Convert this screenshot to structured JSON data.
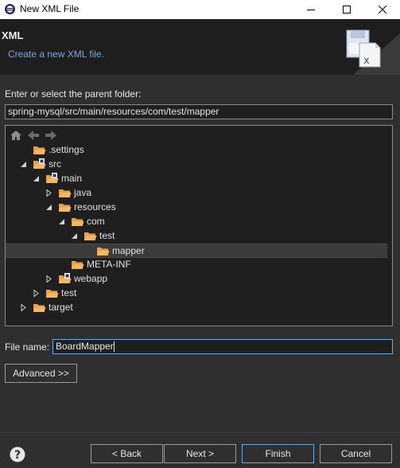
{
  "window": {
    "title": "New XML File",
    "controls": {
      "minimize": "minimize-icon",
      "maximize": "maximize-icon",
      "close": "close-icon"
    }
  },
  "header": {
    "title": "XML",
    "description": "Create a new XML file."
  },
  "parent_folder": {
    "label": "Enter or select the parent folder:",
    "value": "spring-mysql/src/main/resources/com/test/mapper"
  },
  "tree": {
    "toolbar": [
      "home-icon",
      "back-arrow-icon",
      "forward-arrow-icon"
    ],
    "nodes": [
      {
        "label": ".settings",
        "expander": "none",
        "badge": false,
        "selected": false
      },
      {
        "label": "src",
        "expander": "expanded",
        "badge": true,
        "selected": false
      },
      {
        "label": "main",
        "expander": "expanded",
        "badge": true,
        "selected": false
      },
      {
        "label": "java",
        "expander": "collapsed",
        "badge": false,
        "selected": false
      },
      {
        "label": "resources",
        "expander": "expanded",
        "badge": false,
        "selected": false
      },
      {
        "label": "com",
        "expander": "expanded",
        "badge": false,
        "selected": false
      },
      {
        "label": "test",
        "expander": "expanded",
        "badge": false,
        "selected": false
      },
      {
        "label": "mapper",
        "expander": "none",
        "badge": false,
        "selected": true
      },
      {
        "label": "META-INF",
        "expander": "none",
        "badge": false,
        "selected": false
      },
      {
        "label": "webapp",
        "expander": "collapsed",
        "badge": true,
        "selected": false
      },
      {
        "label": "test",
        "expander": "collapsed",
        "badge": false,
        "selected": false
      },
      {
        "label": "target",
        "expander": "collapsed",
        "badge": false,
        "selected": false
      }
    ]
  },
  "file_name": {
    "label": "File name:",
    "value": "BoardMapper"
  },
  "buttons": {
    "advanced": "Advanced >>",
    "back": "< Back",
    "next": "Next >",
    "finish": "Finish",
    "cancel": "Cancel"
  },
  "colors": {
    "background": "#2f2f2f",
    "header_background": "#1e1e1e",
    "accent": "#6fa8dc",
    "folder": "#e8a14a"
  }
}
